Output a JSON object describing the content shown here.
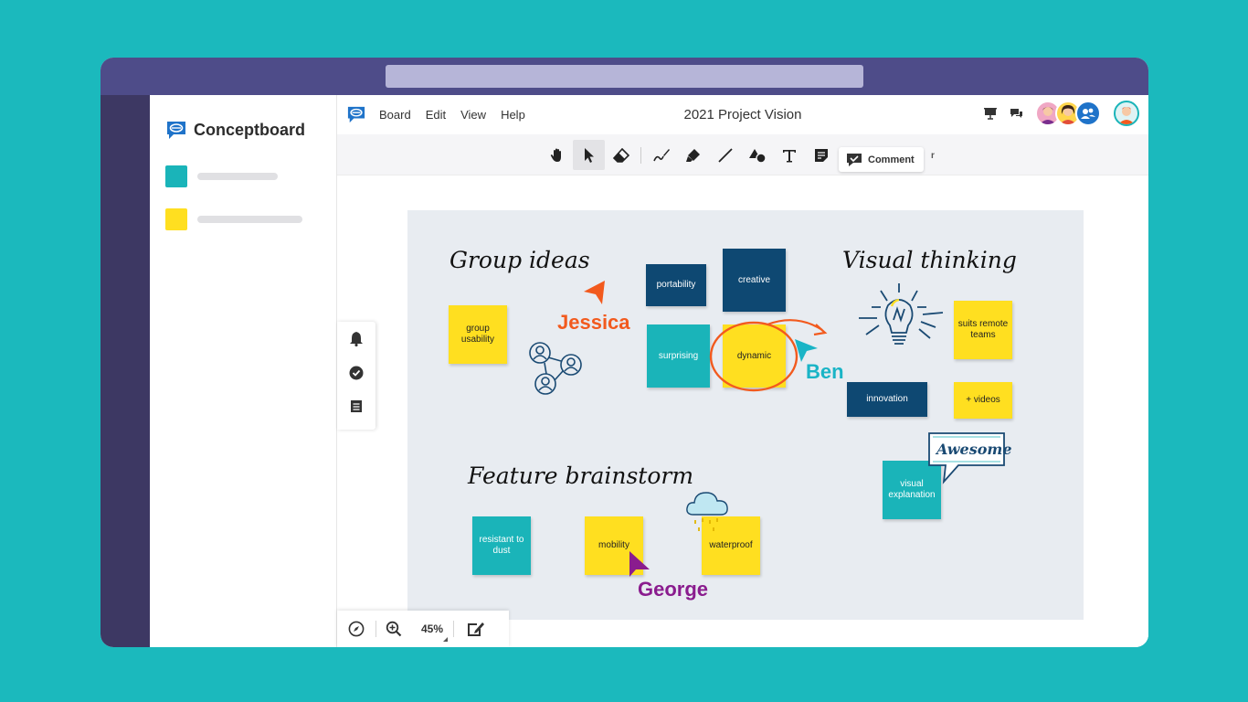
{
  "app": {
    "brand": "Conceptboard",
    "board_title": "2021 Project Vision",
    "menu": [
      "Board",
      "Edit",
      "View",
      "Help"
    ]
  },
  "toolbar": {
    "tools": [
      "hand",
      "select",
      "eraser",
      "pen",
      "highlighter",
      "line",
      "shapes",
      "text",
      "sticky-note"
    ],
    "active_tool": "select",
    "tooltip": "Comment",
    "tooltip_trailing": "r"
  },
  "zoom": {
    "value": "45%"
  },
  "board": {
    "headings": {
      "group_ideas": "Group ideas",
      "visual_thinking": "Visual thinking",
      "feature_brainstorm": "Feature brainstorm"
    },
    "notes": {
      "group_usability": "group usability",
      "portability": "portability",
      "creative": "creative",
      "surprising": "surprising",
      "dynamic": "dynamic",
      "suits_remote": "suits remote teams",
      "innovation": "innovation",
      "videos": "+ videos",
      "visual_explanation": "visual explanation",
      "resistant": "resistant to dust",
      "mobility": "mobility",
      "waterproof": "waterproof"
    },
    "callout": "Awesome",
    "cursors": {
      "jessica": "Jessica",
      "ben": "Ben",
      "george": "George"
    }
  },
  "colors": {
    "background": "#1bb9bd",
    "titlebar": "#4e4c89",
    "yellow": "#ffdf20",
    "teal": "#1ab4b9",
    "navy": "#0e4872",
    "jessica": "#f25a1e",
    "ben": "#1ab4c6",
    "george": "#8a1c8e"
  }
}
